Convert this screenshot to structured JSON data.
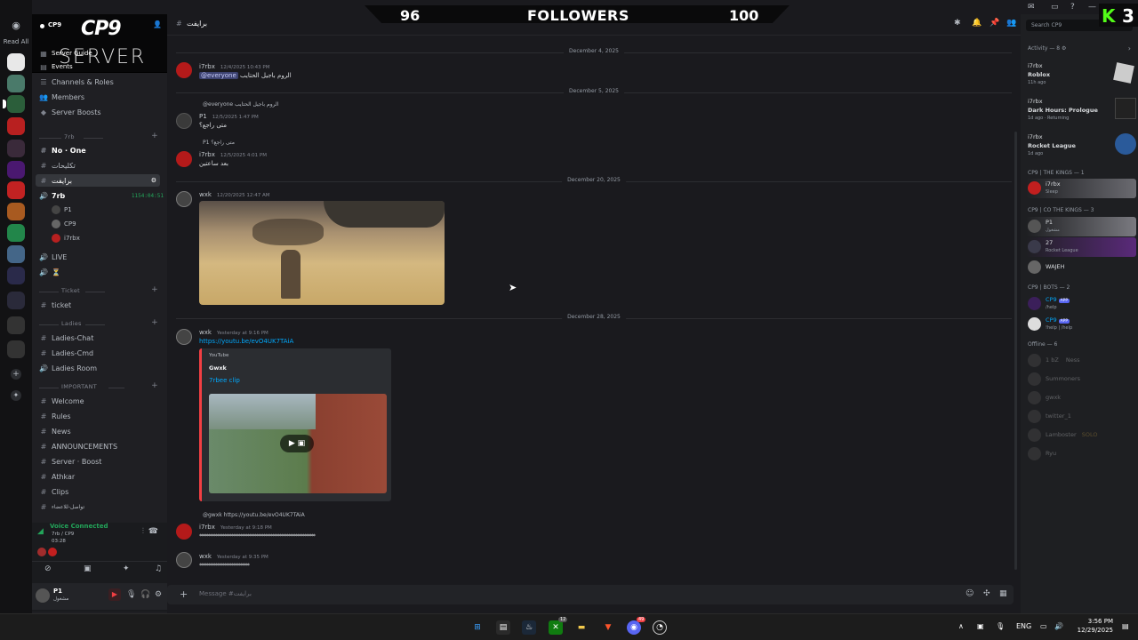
{
  "overlay": {
    "followers_current": "96",
    "followers_label": "FOLLOWERS",
    "followers_goal": "100",
    "kick_logo": "K",
    "kick_count": "3"
  },
  "rail": {
    "home_icon": "discord-icon",
    "read_all": "Read All"
  },
  "server": {
    "name": "CP9",
    "banner_title": "CP9",
    "banner_subtitle": "SERVER",
    "menu": [
      "Server Guide",
      "Events",
      "Channels & Roles",
      "Members",
      "Server Boosts"
    ],
    "categories": [
      {
        "name": "7rb",
        "channels": [
          {
            "label": "No · One",
            "type": "text"
          },
          {
            "label": "تكليحات",
            "type": "text"
          },
          {
            "label": "برايفت",
            "type": "text",
            "selected": true
          },
          {
            "label": "7rb",
            "type": "voice"
          }
        ]
      },
      {
        "name": "Ticket",
        "channels": [
          {
            "label": "ticket",
            "type": "text"
          }
        ]
      },
      {
        "name": "Ladies",
        "channels": [
          {
            "label": "Ladies-Chat",
            "type": "text"
          },
          {
            "label": "Ladies-Cmd",
            "type": "text"
          },
          {
            "label": "Ladies Room",
            "type": "voice"
          }
        ]
      },
      {
        "name": "IMPORTANT",
        "channels": [
          {
            "label": "Welcome",
            "type": "text"
          },
          {
            "label": "Rules",
            "type": "text"
          },
          {
            "label": "News",
            "type": "text"
          },
          {
            "label": "ANNOUNCEMENTS",
            "type": "text"
          },
          {
            "label": "Server · Boost",
            "type": "text"
          },
          {
            "label": "Athkar",
            "type": "text"
          },
          {
            "label": "Clips",
            "type": "text"
          },
          {
            "label": "تواصل-للاعضاء",
            "type": "text"
          }
        ]
      }
    ],
    "voice_users": [
      {
        "name": "P1"
      },
      {
        "name": "CP9"
      },
      {
        "name": "i7rbx"
      }
    ],
    "voice_timer": "1154:04:51",
    "extra_voice": [
      {
        "label": "LIVE"
      },
      {
        "label": "⏳"
      }
    ]
  },
  "voice_panel": {
    "status": "Voice Connected",
    "channel": "7rb / CP9",
    "time": "03:28",
    "user": "P1",
    "user_status": "مشغول"
  },
  "channel_header": {
    "name": "برايفت",
    "search_placeholder": "Search CP9"
  },
  "messages": {
    "dates": [
      "December 4, 2025",
      "December 5, 2025",
      "December 20, 2025",
      "December 28, 2025"
    ],
    "m1": {
      "author": "i7rbx",
      "time": "12/4/2025 10:43 PM",
      "mention": "@everyone",
      "text": "الروم باجيل الحتايب"
    },
    "m2": {
      "reply": "@everyone الروم باجيل الحتايب",
      "author": "P1",
      "time": "12/5/2025 1:47 PM",
      "text": "متى راجع؟"
    },
    "m3": {
      "reply": "P1 متى راجع؟",
      "author": "i7rbx",
      "time": "12/5/2025 4:01 PM",
      "text": "بعد ساعتين"
    },
    "m4": {
      "author": "wxk",
      "time": "12/20/2025 12:47 AM"
    },
    "m5": {
      "author": "wxk",
      "time": "Yesterday at 9:16 PM",
      "link": "https://youtu.be/evO4UK7TAiA",
      "embed_provider": "YouTube",
      "embed_author": "Gwxk",
      "embed_title": "7rbee clip"
    },
    "m6": {
      "reply": "@gwxk https://youtu.be/evO4UK7TAiA",
      "author": "i7rbx",
      "time": "Yesterday at 9:18 PM",
      "text": "*****************************************************************"
    },
    "m7": {
      "author": "wxk",
      "time": "Yesterday at 9:35 PM",
      "text": "****************************"
    }
  },
  "composer": {
    "placeholder": "Message #برايفت"
  },
  "members": {
    "activity_header": "Activity — 8",
    "activities": [
      {
        "name": "i7rbx",
        "game": "Roblox",
        "detail": "11h ago"
      },
      {
        "name": "i7rbx",
        "game": "Dark Hours: Prologue",
        "detail": "1d ago · Returning"
      },
      {
        "name": "i7rbx",
        "game": "Rocket League",
        "detail": "1d ago"
      }
    ],
    "groups": [
      {
        "title": "CP9 | THE KINGS — 1",
        "members": [
          {
            "name": "i7rbx",
            "sub": "Sleep"
          }
        ]
      },
      {
        "title": "CP9 | CO THE KINGS — 3",
        "members": [
          {
            "name": "P1",
            "sub": "مشغول"
          },
          {
            "name": "27",
            "sub": "Rocket League"
          },
          {
            "name": "WAJEH",
            "sub": ""
          }
        ]
      },
      {
        "title": "CP9 | BOTS — 2",
        "members": [
          {
            "name": "CP9",
            "sub": "/help",
            "badge": "APP"
          },
          {
            "name": "CP9",
            "sub": "!help | /help",
            "badge": "APP"
          }
        ]
      },
      {
        "title": "Offline — 6",
        "members": [
          {
            "name": "1 bZ",
            "sub": "Ness"
          },
          {
            "name": "Summoners",
            "sub": ""
          },
          {
            "name": "gwxk",
            "sub": ""
          },
          {
            "name": "twitter_1",
            "sub": ""
          },
          {
            "name": "Lamboster",
            "sub": "SOLO"
          },
          {
            "name": "Ryu",
            "sub": ""
          }
        ]
      }
    ]
  },
  "taskbar": {
    "lang": "ENG",
    "time": "3:56 PM",
    "date": "12/29/2025",
    "badge_xbox": "12",
    "badge_discord": "49"
  }
}
